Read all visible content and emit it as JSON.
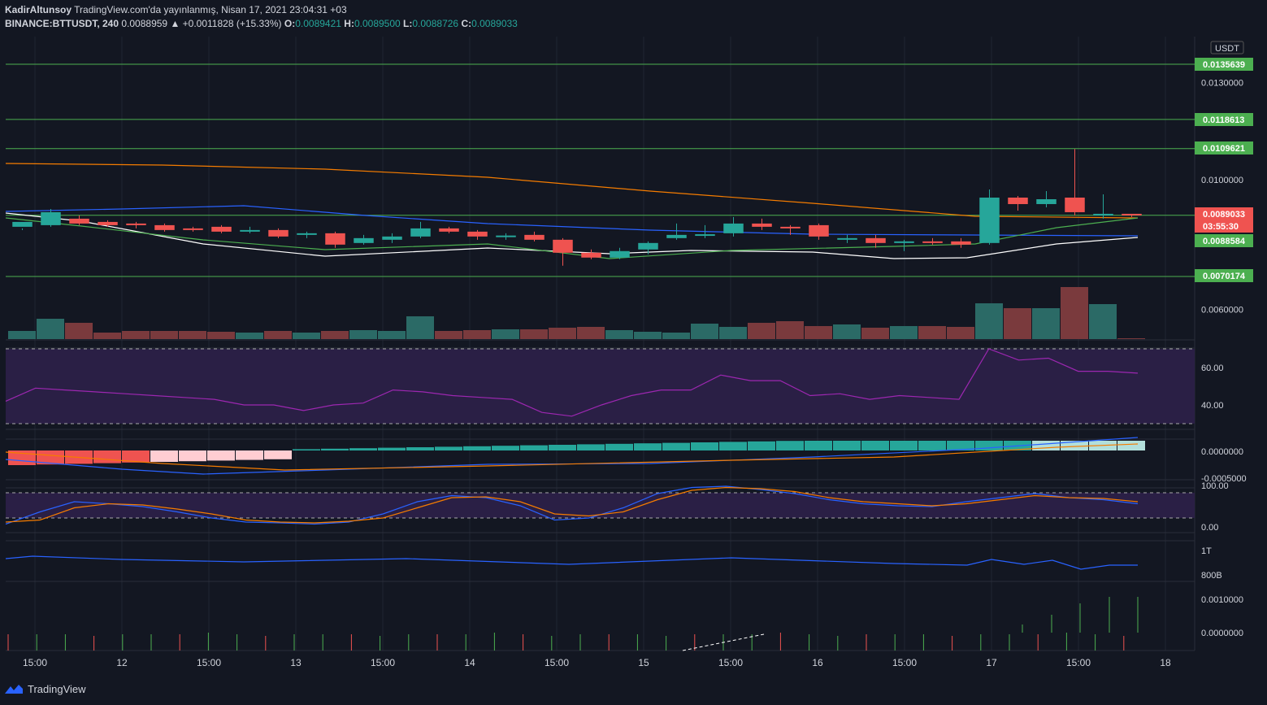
{
  "header": {
    "author": "KadirAltunsoy",
    "published": "TradingView.com'da yayınlanmış, Nisan 17, 2021 23:04:31 +03",
    "symbol": "BINANCE:BTTUSDT, 240",
    "last": "0.0088959",
    "change": "▲ +0.0011828 (+15.33%)",
    "o_label": "O:",
    "o": "0.0089421",
    "h_label": "H:",
    "h": "0.0089500",
    "l_label": "L:",
    "l": "0.0088726",
    "c_label": "C:",
    "c": "0.0089033"
  },
  "footer": {
    "brand": "TradingView"
  },
  "colors": {
    "bg": "#131722",
    "up": "#26a69a",
    "down": "#ef5350",
    "grid": "#1f2433",
    "hline": "#4caf50",
    "ma_blue": "#2962ff",
    "ma_orange": "#f57c00",
    "ma_white": "#ffffff",
    "ma_green": "#4caf50",
    "rsi": "#9c27b0"
  },
  "chart_data": {
    "type": "candlestick",
    "currency": "USDT",
    "price_axis_labels": [
      "0.0130000",
      "0.0100000",
      "0.0060000"
    ],
    "price_tags": [
      {
        "value": "0.0135639",
        "color": "#4caf50"
      },
      {
        "value": "0.0118613",
        "color": "#4caf50"
      },
      {
        "value": "0.0109621",
        "color": "#4caf50"
      },
      {
        "value": "0.0089033",
        "color": "#ef5350"
      },
      {
        "value": "03:55:30",
        "color": "#ef5350"
      },
      {
        "value": "0.0088584",
        "color": "#4caf50"
      },
      {
        "value": "0.0070174",
        "color": "#4caf50"
      }
    ],
    "horizontal_levels": [
      0.0135639,
      0.0118613,
      0.0109621,
      0.0089033,
      0.0070174
    ],
    "x_ticks": [
      "15:00",
      "12",
      "15:00",
      "13",
      "15:00",
      "14",
      "15:00",
      "15",
      "15:00",
      "16",
      "15:00",
      "17",
      "15:00",
      "18"
    ],
    "candles": [
      [
        0.00855,
        0.0087,
        0.0085,
        0.00845
      ],
      [
        0.0086,
        0.009,
        0.0091,
        0.00855
      ],
      [
        0.0088,
        0.00865,
        0.0089,
        0.0086
      ],
      [
        0.0087,
        0.0086,
        0.00875,
        0.00855
      ],
      [
        0.00865,
        0.0086,
        0.0087,
        0.0085
      ],
      [
        0.0086,
        0.00845,
        0.00865,
        0.0084
      ],
      [
        0.0085,
        0.00845,
        0.00855,
        0.0084
      ],
      [
        0.00855,
        0.0084,
        0.0086,
        0.00835
      ],
      [
        0.0084,
        0.00845,
        0.00855,
        0.00835
      ],
      [
        0.00845,
        0.00825,
        0.0085,
        0.0082
      ],
      [
        0.0083,
        0.00835,
        0.0084,
        0.0082
      ],
      [
        0.00835,
        0.008,
        0.0084,
        0.0079
      ],
      [
        0.00805,
        0.0082,
        0.0083,
        0.008
      ],
      [
        0.00815,
        0.00825,
        0.00835,
        0.00805
      ],
      [
        0.00825,
        0.0085,
        0.0087,
        0.0082
      ],
      [
        0.0085,
        0.0084,
        0.00855,
        0.00835
      ],
      [
        0.0084,
        0.00825,
        0.00845,
        0.00815
      ],
      [
        0.00825,
        0.00828,
        0.00835,
        0.00815
      ],
      [
        0.0083,
        0.00815,
        0.0084,
        0.0081
      ],
      [
        0.00815,
        0.00775,
        0.0082,
        0.00735
      ],
      [
        0.00775,
        0.0076,
        0.00785,
        0.00755
      ],
      [
        0.0076,
        0.0078,
        0.0079,
        0.00755
      ],
      [
        0.00785,
        0.00805,
        0.0081,
        0.0077
      ],
      [
        0.0082,
        0.0083,
        0.00865,
        0.00815
      ],
      [
        0.0083,
        0.00832,
        0.0086,
        0.0082
      ],
      [
        0.00835,
        0.00865,
        0.00885,
        0.00825
      ],
      [
        0.00865,
        0.00855,
        0.0088,
        0.00845
      ],
      [
        0.00855,
        0.0085,
        0.0086,
        0.0083
      ],
      [
        0.0086,
        0.00825,
        0.00865,
        0.00815
      ],
      [
        0.00815,
        0.0082,
        0.0083,
        0.00805
      ],
      [
        0.0082,
        0.00805,
        0.0083,
        0.0079
      ],
      [
        0.00805,
        0.0081,
        0.00815,
        0.0078
      ],
      [
        0.0081,
        0.00805,
        0.0082,
        0.008
      ],
      [
        0.0081,
        0.008,
        0.0082,
        0.0079
      ],
      [
        0.00805,
        0.00945,
        0.0097,
        0.008
      ],
      [
        0.00945,
        0.00925,
        0.0095,
        0.00905
      ],
      [
        0.00925,
        0.0094,
        0.00965,
        0.00915
      ],
      [
        0.00945,
        0.009,
        0.01095,
        0.0089
      ],
      [
        0.00895,
        0.00895,
        0.00955,
        0.0088
      ],
      [
        0.00895,
        0.0089,
        0.00895,
        0.00885
      ]
    ],
    "volume_labels": [
      "1T",
      "800B"
    ],
    "rsi_labels": [
      "60.00",
      "40.00"
    ],
    "macd_labels": [
      "0.0000000",
      "-0.0005000"
    ],
    "stoch_labels": [
      "100.00",
      "0.00"
    ],
    "osc_labels": [
      "0.0010000",
      "0.0000000"
    ],
    "rsi": [
      42,
      49,
      48,
      47,
      46,
      45,
      44,
      43,
      40,
      40,
      37,
      40,
      41,
      48,
      47,
      45,
      44,
      43,
      36,
      34,
      40,
      45,
      48,
      48,
      56,
      53,
      53,
      45,
      46,
      43,
      45,
      44,
      43,
      70,
      64,
      65,
      58,
      58,
      57
    ],
    "stoch_k": [
      5,
      35,
      60,
      55,
      48,
      35,
      20,
      10,
      8,
      5,
      10,
      30,
      60,
      75,
      70,
      50,
      15,
      20,
      45,
      80,
      95,
      98,
      90,
      80,
      65,
      55,
      50,
      48,
      60,
      70,
      80,
      70,
      65,
      55
    ],
    "stoch_d": [
      10,
      15,
      45,
      55,
      52,
      42,
      30,
      15,
      10,
      8,
      12,
      20,
      45,
      70,
      72,
      60,
      30,
      25,
      35,
      65,
      88,
      95,
      92,
      85,
      70,
      60,
      55,
      50,
      55,
      65,
      75,
      70,
      68,
      60
    ],
    "vol_hist": [
      10,
      25,
      20,
      8,
      10,
      10,
      10,
      9,
      8,
      10,
      8,
      10,
      11,
      10,
      28,
      10,
      11,
      12,
      12,
      14,
      15,
      11,
      9,
      8,
      19,
      15,
      20,
      22,
      16,
      18,
      14,
      16,
      16,
      15,
      44,
      38,
      38,
      64,
      43,
      1
    ]
  }
}
